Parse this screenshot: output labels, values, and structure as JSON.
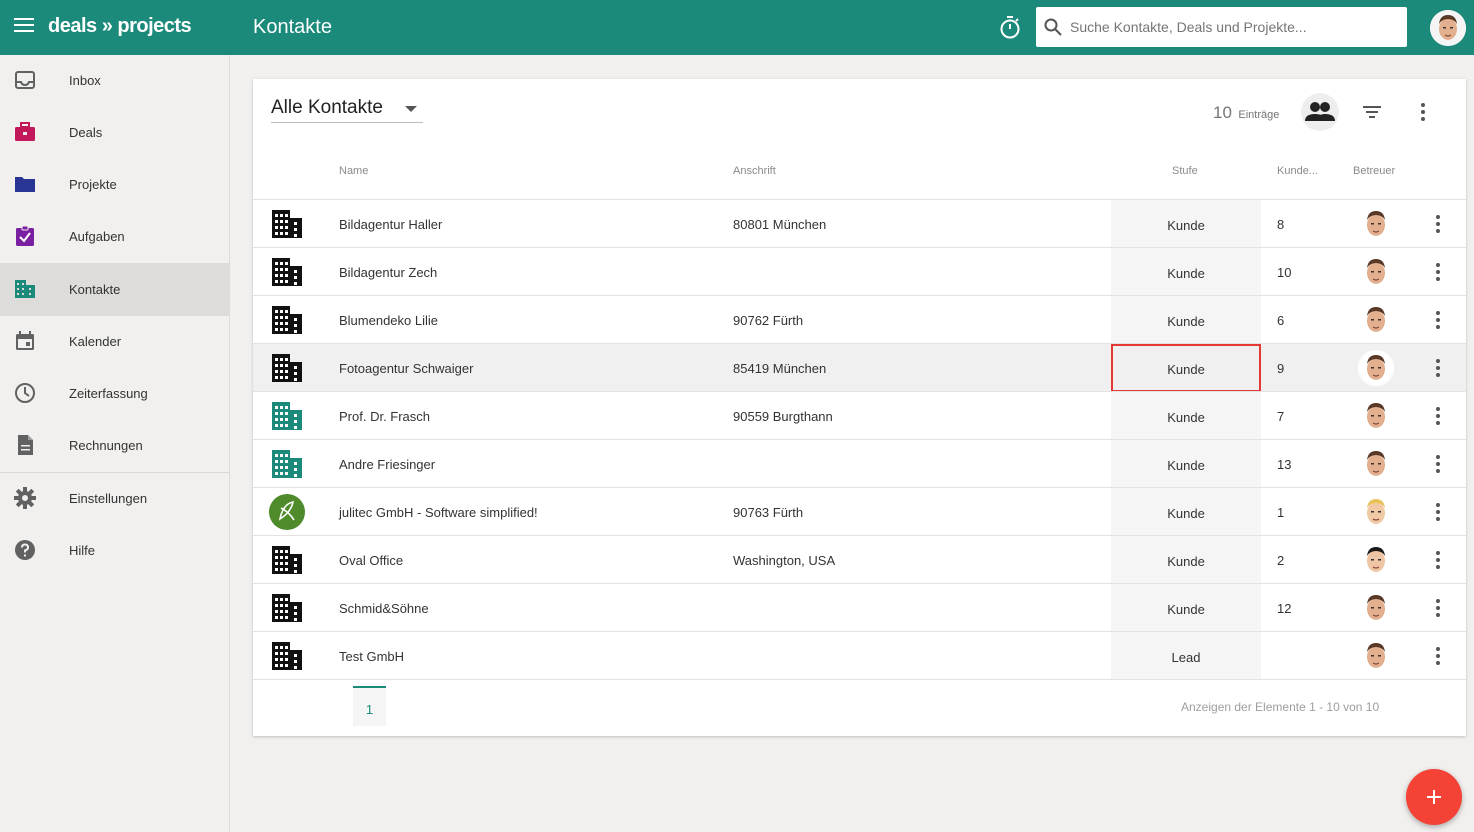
{
  "app": {
    "logo": "deals » projects",
    "page_title": "Kontakte"
  },
  "search": {
    "placeholder": "Suche Kontakte, Deals und Projekte..."
  },
  "sidebar": {
    "items": [
      {
        "label": "Inbox",
        "icon": "inbox-icon",
        "color": "#616161"
      },
      {
        "label": "Deals",
        "icon": "briefcase-icon",
        "color": "#c2185b"
      },
      {
        "label": "Projekte",
        "icon": "folder-icon",
        "color": "#283593"
      },
      {
        "label": "Aufgaben",
        "icon": "task-icon",
        "color": "#7b1fa2"
      },
      {
        "label": "Kontakte",
        "icon": "building-icon",
        "color": "#1b8a7b",
        "active": true
      },
      {
        "label": "Kalender",
        "icon": "calendar-icon",
        "color": "#616161"
      },
      {
        "label": "Zeiterfassung",
        "icon": "clock-icon",
        "color": "#616161"
      },
      {
        "label": "Rechnungen",
        "icon": "document-icon",
        "color": "#616161"
      },
      {
        "label": "Einstellungen",
        "icon": "gear-icon",
        "color": "#616161"
      },
      {
        "label": "Hilfe",
        "icon": "help-icon",
        "color": "#616161"
      }
    ]
  },
  "toolbar": {
    "view": "Alle Kontakte",
    "count": "10",
    "count_unit": "Einträge"
  },
  "table": {
    "headers": {
      "name": "Name",
      "address": "Anschrift",
      "stage": "Stufe",
      "customer": "Kunde...",
      "owner": "Betreuer"
    },
    "rows": [
      {
        "name": "Bildagentur Haller",
        "address": "80801 München",
        "stage": "Kunde",
        "num": "8",
        "icon": "building-icon-black"
      },
      {
        "name": "Bildagentur Zech",
        "address": "",
        "stage": "Kunde",
        "num": "10",
        "icon": "building-icon-black"
      },
      {
        "name": "Blumendeko Lilie",
        "address": "90762 Fürth",
        "stage": "Kunde",
        "num": "6",
        "icon": "building-icon-black"
      },
      {
        "name": "Fotoagentur Schwaiger",
        "address": "85419 München",
        "stage": "Kunde",
        "num": "9",
        "icon": "building-icon-black"
      },
      {
        "name": "Prof. Dr. Frasch",
        "address": "90559 Burgthann",
        "stage": "Kunde",
        "num": "7",
        "icon": "building-icon-teal"
      },
      {
        "name": "Andre Friesinger",
        "address": "",
        "stage": "Kunde",
        "num": "13",
        "icon": "building-icon-teal"
      },
      {
        "name": "julitec GmbH - Software simplified!",
        "address": "90763 Fürth",
        "stage": "Kunde",
        "num": "1",
        "icon": "julitec-logo-icon"
      },
      {
        "name": "Oval Office",
        "address": "Washington, USA",
        "stage": "Kunde",
        "num": "2",
        "icon": "building-icon-black"
      },
      {
        "name": "Schmid&Söhne",
        "address": "",
        "stage": "Kunde",
        "num": "12",
        "icon": "building-icon-black"
      },
      {
        "name": "Test GmbH",
        "address": "",
        "stage": "Lead",
        "num": "",
        "icon": "building-icon-black"
      }
    ]
  },
  "pagination": {
    "page": "1",
    "info": "Anzeigen der Elemente 1 - 10 von 10"
  },
  "colors": {
    "primary": "#1b8a7b",
    "accent": "#f44336",
    "highlight": "#e53935"
  }
}
